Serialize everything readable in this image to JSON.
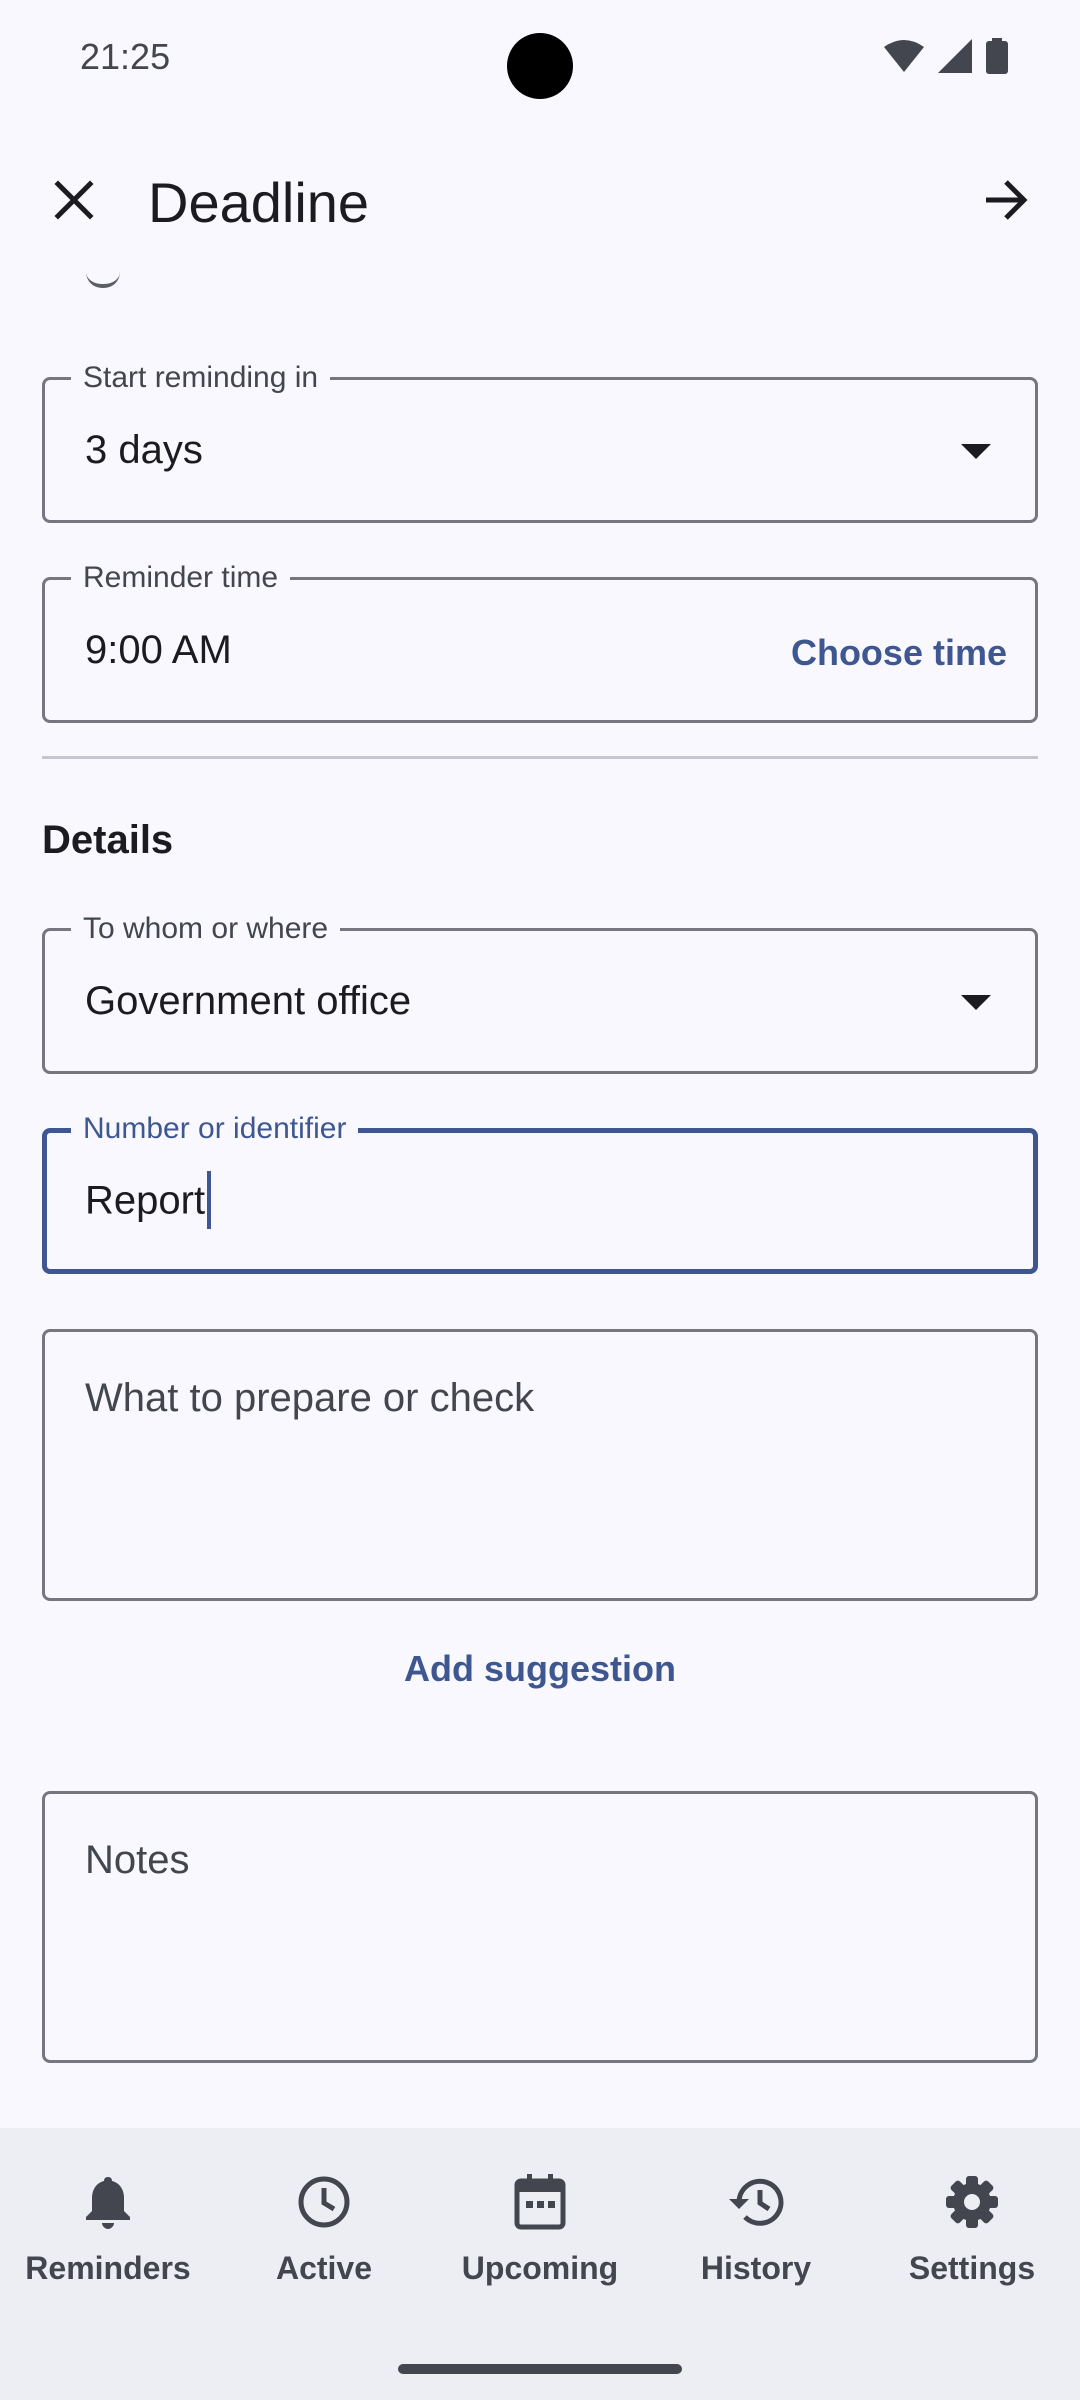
{
  "status_bar": {
    "time": "21:25",
    "icons": [
      "wifi-icon",
      "signal-icon",
      "battery-icon"
    ]
  },
  "top_bar": {
    "title": "Deadline",
    "close_icon": "close-icon",
    "next_icon": "arrow-forward-icon"
  },
  "form": {
    "start_reminding": {
      "label": "Start reminding in",
      "value": "3 days"
    },
    "reminder_time": {
      "label": "Reminder time",
      "value": "9:00 AM",
      "action": "Choose time"
    },
    "details_title": "Details",
    "to_whom": {
      "label": "To whom or where",
      "value": "Government office"
    },
    "identifier": {
      "label": "Number or identifier",
      "value": "Report"
    },
    "prepare": {
      "placeholder": "What to prepare or check"
    },
    "add_suggestion": "Add suggestion",
    "notes": {
      "placeholder": "Notes"
    }
  },
  "bottom_nav": {
    "items": [
      {
        "label": "Reminders",
        "icon": "bell-icon"
      },
      {
        "label": "Active",
        "icon": "clock-icon"
      },
      {
        "label": "Upcoming",
        "icon": "calendar-icon"
      },
      {
        "label": "History",
        "icon": "history-icon"
      },
      {
        "label": "Settings",
        "icon": "gear-icon"
      }
    ]
  },
  "colors": {
    "background": "#f8f8fe",
    "primary": "#3f5791",
    "outline": "#757680",
    "nav_background": "#ededf4",
    "on_surface": "#1b1b21",
    "on_surface_variant": "#44464f"
  }
}
